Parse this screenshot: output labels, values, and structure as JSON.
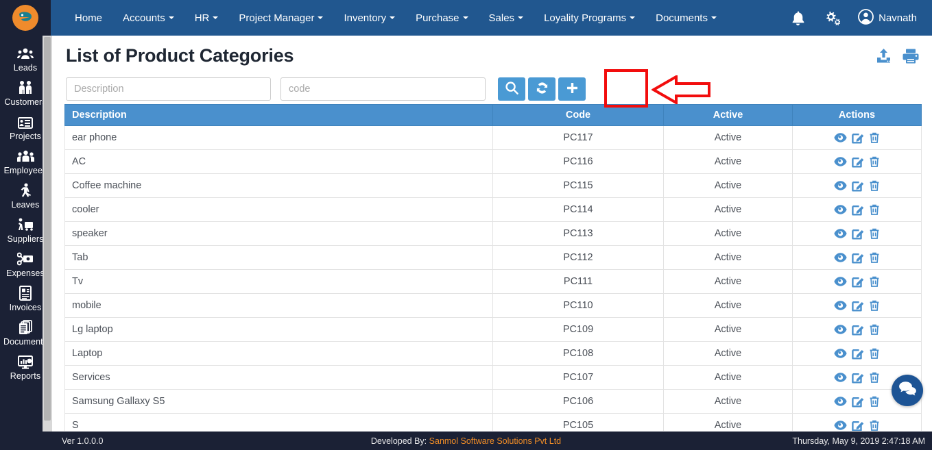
{
  "brand": {
    "logo_letter": "e",
    "logo_color": "#ef8b2c"
  },
  "colors": {
    "navbar": "#21578f",
    "sidebar": "#1b2135",
    "table_header": "#4a90cd",
    "button_blue": "#4a9ad4",
    "annotation_red": "#f20d0d",
    "footer_link": "#f08d27"
  },
  "topnav": {
    "items": [
      {
        "label": "Home",
        "has_caret": false
      },
      {
        "label": "Accounts",
        "has_caret": true
      },
      {
        "label": "HR",
        "has_caret": true
      },
      {
        "label": "Project Manager",
        "has_caret": true
      },
      {
        "label": "Inventory",
        "has_caret": true
      },
      {
        "label": "Purchase",
        "has_caret": true
      },
      {
        "label": "Sales",
        "has_caret": true
      },
      {
        "label": "Loyality Programs",
        "has_caret": true
      },
      {
        "label": "Documents",
        "has_caret": true
      }
    ],
    "notification_icon": "bell-icon",
    "settings_icon": "gears-icon",
    "user_icon": "user-circle-icon",
    "user_name": "Navnath"
  },
  "sidebar": {
    "items": [
      {
        "label": "Leads",
        "icon": "leads-icon"
      },
      {
        "label": "Customers",
        "icon": "customers-icon"
      },
      {
        "label": "Projects",
        "icon": "projects-icon"
      },
      {
        "label": "Employees",
        "icon": "employees-icon"
      },
      {
        "label": "Leaves",
        "icon": "leaves-icon"
      },
      {
        "label": "Suppliers",
        "icon": "suppliers-icon"
      },
      {
        "label": "Expenses",
        "icon": "expenses-icon"
      },
      {
        "label": "Invoices",
        "icon": "invoices-icon"
      },
      {
        "label": "Documents",
        "icon": "documents-icon"
      },
      {
        "label": "Reports",
        "icon": "reports-icon"
      }
    ]
  },
  "page": {
    "title": "List of Product Categories",
    "export_icon": "upload-icon",
    "print_icon": "printer-icon"
  },
  "toolbar": {
    "description_placeholder": "Description",
    "description_value": "",
    "code_placeholder": "code",
    "code_value": "",
    "search_icon": "search-icon",
    "refresh_icon": "refresh-icon",
    "add_icon": "plus-icon"
  },
  "annotation": {
    "highlight_target": "add-button",
    "arrow_direction": "left",
    "color": "#f20d0d"
  },
  "table": {
    "columns": [
      "Description",
      "Code",
      "Active",
      "Actions"
    ],
    "action_icons": [
      "view-eye-icon",
      "edit-pencil-icon",
      "delete-trash-icon"
    ],
    "rows": [
      {
        "description": "ear phone",
        "code": "PC117",
        "active": "Active"
      },
      {
        "description": "AC",
        "code": "PC116",
        "active": "Active"
      },
      {
        "description": "Coffee machine",
        "code": "PC115",
        "active": "Active"
      },
      {
        "description": "cooler",
        "code": "PC114",
        "active": "Active"
      },
      {
        "description": "speaker",
        "code": "PC113",
        "active": "Active"
      },
      {
        "description": "Tab",
        "code": "PC112",
        "active": "Active"
      },
      {
        "description": "Tv",
        "code": "PC111",
        "active": "Active"
      },
      {
        "description": "mobile",
        "code": "PC110",
        "active": "Active"
      },
      {
        "description": "Lg laptop",
        "code": "PC109",
        "active": "Active"
      },
      {
        "description": "Laptop",
        "code": "PC108",
        "active": "Active"
      },
      {
        "description": "Services",
        "code": "PC107",
        "active": "Active"
      },
      {
        "description": "Samsung Gallaxy S5",
        "code": "PC106",
        "active": "Active"
      },
      {
        "description": "S",
        "code": "PC105",
        "active": "Active"
      }
    ]
  },
  "chat": {
    "icon": "chat-bubble-icon"
  },
  "footer": {
    "version": "Ver 1.0.0.0",
    "developed_by_label": "Developed By:",
    "developed_by_company": "Sanmol Software Solutions Pvt Ltd",
    "datetime": "Thursday, May 9, 2019 2:47:18 AM"
  }
}
